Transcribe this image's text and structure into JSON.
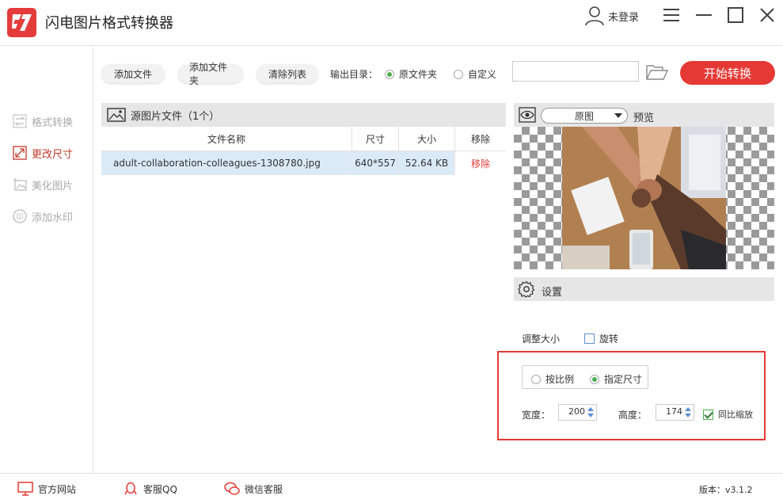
{
  "window": {
    "title": "闪电图片格式转换器",
    "user_label": "未登录"
  },
  "nav": {
    "items": [
      {
        "label": "格式转换",
        "icon": "swap-arrows-icon",
        "active": false
      },
      {
        "label": "更改尺寸",
        "icon": "resize-icon",
        "active": true
      },
      {
        "label": "美化图片",
        "icon": "beautify-image-icon",
        "active": false
      },
      {
        "label": "添加水印",
        "icon": "watermark-icon",
        "active": false
      }
    ]
  },
  "toolbar": {
    "add_file": "添加文件",
    "add_folder": "添加文件夹",
    "clear_list": "清除列表",
    "output_label": "输出目录：",
    "output_options": [
      {
        "label": "原文件夹",
        "selected": true
      },
      {
        "label": "自定义",
        "selected": false
      }
    ],
    "path_value": "",
    "start_label": "开始转换"
  },
  "file_panel": {
    "title": "源图片文件（1个）",
    "columns": [
      "文件名称",
      "尺寸",
      "大小",
      "移除"
    ],
    "rows": [
      {
        "name": "adult-collaboration-colleagues-1308780.jpg",
        "size": "640*557",
        "filesize": "52.64 KB",
        "remove": "移除"
      }
    ]
  },
  "preview": {
    "mode": "原图",
    "label": "预览"
  },
  "settings": {
    "title": "设置",
    "resize_label": "调整大小",
    "rotate_label": "旋转",
    "rotate_checked": false,
    "mode_options": [
      {
        "label": "按比例",
        "selected": false
      },
      {
        "label": "指定尺寸",
        "selected": true
      }
    ],
    "width_label": "宽度：",
    "width_value": "200",
    "height_label": "高度：",
    "height_value": "174",
    "keep_ratio_label": "同比缩放",
    "keep_ratio_checked": true
  },
  "statusbar": {
    "website": "官方网站",
    "qq": "客服QQ",
    "wechat": "微信客服",
    "version": "版本：v3.1.2"
  },
  "colors": {
    "accent": "#e53935",
    "selected_row": "#dbeaf7",
    "header_bg": "#e6e6e6"
  }
}
